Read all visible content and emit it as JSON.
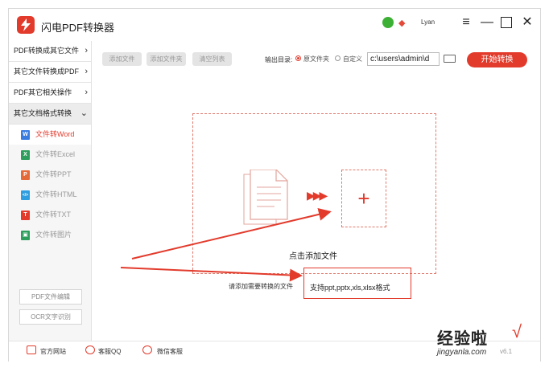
{
  "app": {
    "title": "闪电PDF转换器",
    "user": "Lyan",
    "accent": "#e23b2c"
  },
  "sidebar": {
    "categories": [
      {
        "label": "PDF转换成其它文件"
      },
      {
        "label": "其它文件转换成PDF"
      },
      {
        "label": "PDF其它相关操作"
      },
      {
        "label": "其它文档格式转换"
      }
    ],
    "subitems": [
      {
        "label": "文件转Word",
        "icon": "W",
        "color": "#3a7be0"
      },
      {
        "label": "文件转Excel",
        "icon": "X",
        "color": "#2f9e5c"
      },
      {
        "label": "文件转PPT",
        "icon": "P",
        "color": "#e46a3a"
      },
      {
        "label": "文件转HTML",
        "icon": "</>",
        "color": "#2f9ee0"
      },
      {
        "label": "文件转TXT",
        "icon": "T",
        "color": "#e23b2c"
      },
      {
        "label": "文件转图片",
        "icon": "▣",
        "color": "#2f9e5c"
      }
    ],
    "tools": {
      "pdf_edit": "PDF文件编辑",
      "ocr": "OCR文字识别"
    }
  },
  "toolbar": {
    "add_file": "添加文件",
    "add_folder": "添加文件夹",
    "clear_list": "清空列表",
    "output_label": "输出目录:",
    "option_original": "原文件夹",
    "option_custom": "自定义",
    "path_value": "c:\\users\\admin\\d",
    "start": "开始转换"
  },
  "main": {
    "click_to_add": "点击添加文件",
    "hint": "请添加需要转换的文件",
    "support": "支持ppt,pptx,xls,xlsx格式"
  },
  "bottom": {
    "website": "官方网站",
    "qq": "客服QQ",
    "wechat": "微信客服",
    "version": "v6.1"
  },
  "watermark": {
    "brand": "经验啦",
    "check": "√",
    "url": "jingyanla.com"
  }
}
